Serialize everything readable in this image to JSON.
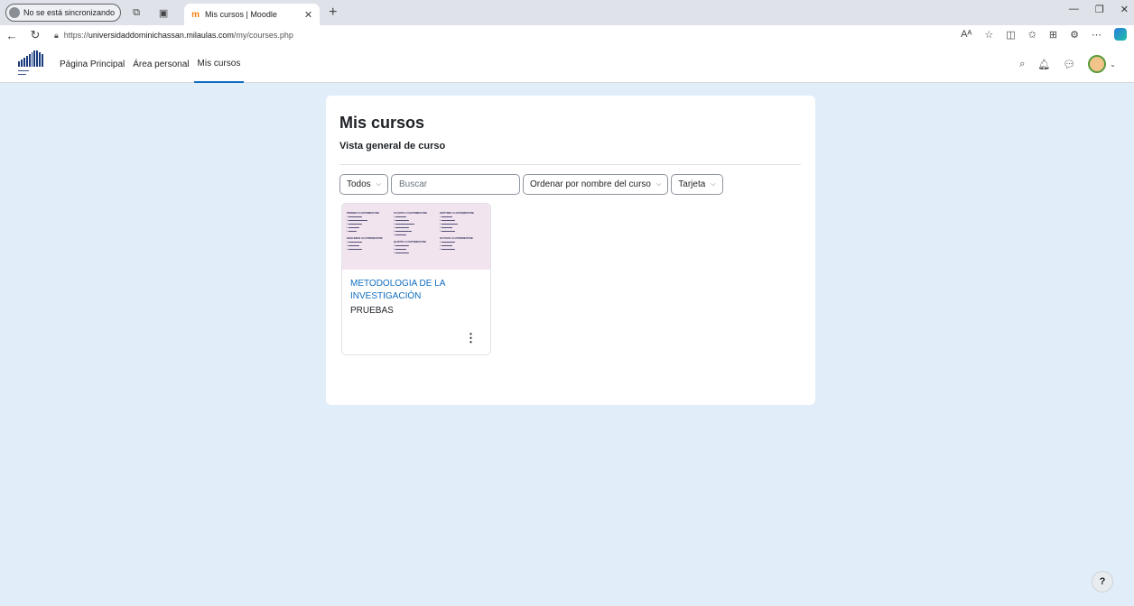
{
  "browser": {
    "sync_label": "No se está sincronizando",
    "tab_title": "Mis cursos | Moodle",
    "tab_favicon": "moodle-icon",
    "url_prefix": "https://",
    "url_host": "universidaddominichassan.milaulas.com",
    "url_path": "/my/courses.php",
    "reader_label": "Aᴬ"
  },
  "header": {
    "nav": [
      "Página Principal",
      "Área personal",
      "Mis cursos"
    ],
    "active_nav": "Mis cursos"
  },
  "main": {
    "title": "Mis cursos",
    "subtitle": "Vista general de curso",
    "filters": {
      "grouping": "Todos",
      "search_placeholder": "Buscar",
      "sort": "Ordenar por nombre del curso",
      "view": "Tarjeta"
    },
    "courses": [
      {
        "name": "METODOLOGIA DE LA INVESTIGACIÓN",
        "category": "PRUEBAS",
        "thumbnail": {
          "col1_heading": "PRIMER CUATRIMESTRE",
          "col1b_heading": "SEGUNDO CUATRIMESTRE",
          "col2_heading": "CUARTO CUATRIMESTRE",
          "col2b_heading": "QUINTO CUATRIMESTRE",
          "col3_heading": "SEPTIMO CUATRIMESTRE",
          "col3b_heading": "OCTAVO CUATRIMESTRE"
        }
      }
    ]
  },
  "help_label": "?",
  "colors": {
    "accent": "#0f6cbf",
    "page_bg": "#e1edf9",
    "moodle_orange": "#f98012"
  }
}
